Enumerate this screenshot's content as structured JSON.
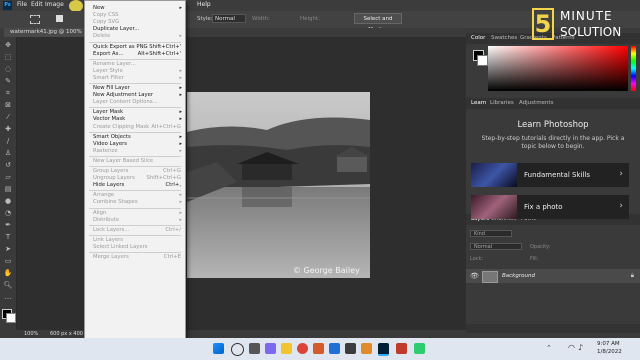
{
  "menubar": {
    "items": [
      "File",
      "Edit",
      "Image",
      "Help"
    ]
  },
  "options_bar": {
    "style_label": "Style:",
    "style_value": "Normal",
    "width_label": "Width:",
    "height_label": "Height:",
    "select_mask": "Select and Mask..."
  },
  "document": {
    "tab_title": "watermark41.jpg @ 100%",
    "zoom": "100%",
    "doc_size": "600 px x 400"
  },
  "watermark_text": "© George Bailey",
  "logo": {
    "number": "5",
    "line1": "MINUTE",
    "line2": "SOLUTION"
  },
  "color_panel": {
    "tabs": [
      "Color",
      "Swatches",
      "Gradients",
      "Patterns"
    ]
  },
  "learn_panel": {
    "tabs": [
      "Learn",
      "Libraries",
      "Adjustments"
    ],
    "title": "Learn Photoshop",
    "description": "Step-by-step tutorials directly in the app. Pick a topic below to begin.",
    "cards": [
      {
        "label": "Fundamental Skills"
      },
      {
        "label": "Fix a photo"
      }
    ]
  },
  "layers_panel": {
    "tabs": [
      "Layers",
      "Channels",
      "Paths"
    ],
    "kind": "Kind",
    "blend": "Normal",
    "opacity_label": "Opacity:",
    "lock_label": "Lock:",
    "fill_label": "Fill:",
    "layer_name": "Background"
  },
  "context_menu": {
    "items": [
      {
        "label": "New",
        "arrow": true,
        "disabled": false
      },
      {
        "label": "Copy CSS",
        "disabled": true
      },
      {
        "label": "Copy SVG",
        "disabled": true
      },
      {
        "label": "Duplicate Layer...",
        "disabled": false
      },
      {
        "label": "Delete",
        "arrow": true,
        "disabled": true
      },
      {
        "sep": true
      },
      {
        "label": "Quick Export as PNG",
        "shortcut": "Shift+Ctrl+'",
        "disabled": false
      },
      {
        "label": "Export As...",
        "shortcut": "Alt+Shift+Ctrl+'",
        "disabled": false
      },
      {
        "sep": true
      },
      {
        "label": "Rename Layer...",
        "disabled": true
      },
      {
        "label": "Layer Style",
        "arrow": true,
        "disabled": true
      },
      {
        "label": "Smart Filter",
        "arrow": true,
        "disabled": true
      },
      {
        "sep": true
      },
      {
        "label": "New Fill Layer",
        "arrow": true,
        "disabled": false
      },
      {
        "label": "New Adjustment Layer",
        "arrow": true,
        "disabled": false
      },
      {
        "label": "Layer Content Options...",
        "disabled": true
      },
      {
        "sep": true
      },
      {
        "label": "Layer Mask",
        "arrow": true,
        "disabled": false
      },
      {
        "label": "Vector Mask",
        "arrow": true,
        "disabled": false
      },
      {
        "label": "Create Clipping Mask",
        "shortcut": "Alt+Ctrl+G",
        "disabled": true
      },
      {
        "sep": true
      },
      {
        "label": "Smart Objects",
        "arrow": true,
        "disabled": false
      },
      {
        "label": "Video Layers",
        "arrow": true,
        "disabled": false
      },
      {
        "label": "Rasterize",
        "arrow": true,
        "disabled": true
      },
      {
        "sep": true
      },
      {
        "label": "New Layer Based Slice",
        "disabled": true
      },
      {
        "sep": true
      },
      {
        "label": "Group Layers",
        "shortcut": "Ctrl+G",
        "disabled": true
      },
      {
        "label": "Ungroup Layers",
        "shortcut": "Shift+Ctrl+G",
        "disabled": true
      },
      {
        "label": "Hide Layers",
        "shortcut": "Ctrl+,",
        "disabled": false
      },
      {
        "sep": true
      },
      {
        "label": "Arrange",
        "arrow": true,
        "disabled": true
      },
      {
        "label": "Combine Shapes",
        "arrow": true,
        "disabled": true
      },
      {
        "sep": true
      },
      {
        "label": "Align",
        "arrow": true,
        "disabled": true
      },
      {
        "label": "Distribute",
        "arrow": true,
        "disabled": true
      },
      {
        "sep": true
      },
      {
        "label": "Lock Layers...",
        "shortcut": "Ctrl+/",
        "disabled": true
      },
      {
        "sep": true
      },
      {
        "label": "Link Layers",
        "disabled": true
      },
      {
        "label": "Select Linked Layers",
        "disabled": true
      },
      {
        "sep": true
      },
      {
        "label": "Merge Layers",
        "shortcut": "Ctrl+E",
        "disabled": true
      }
    ]
  },
  "taskbar": {
    "time": "9:07 AM",
    "date": "1/8/2022"
  }
}
